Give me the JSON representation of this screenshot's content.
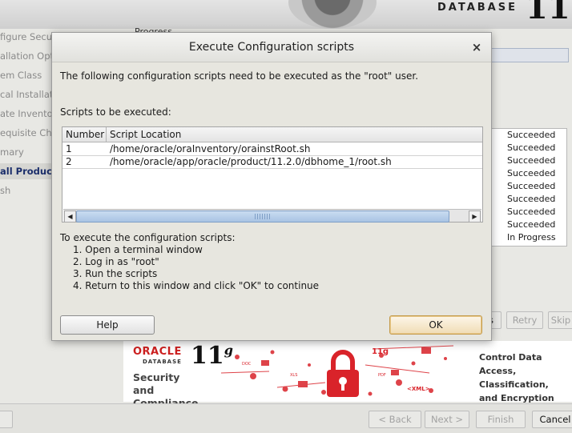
{
  "background": {
    "brand_text": "DATABASE",
    "brand_number": "11",
    "progress_link": "Progress",
    "sidebar": [
      {
        "label": "figure Secur",
        "active": false
      },
      {
        "label": "allation Opti",
        "active": false
      },
      {
        "label": "em Class",
        "active": false
      },
      {
        "label": "cal Installati",
        "active": false
      },
      {
        "label": "ate Inventory",
        "active": false
      },
      {
        "label": "equisite Che",
        "active": false
      },
      {
        "label": "mary",
        "active": false
      },
      {
        "label": "all Product",
        "active": true
      },
      {
        "label": "sh",
        "active": false
      }
    ],
    "status_items": [
      "Succeeded",
      "Succeeded",
      "Succeeded",
      "Succeeded",
      "Succeeded",
      "Succeeded",
      "Succeeded",
      "Succeeded",
      "In Progress"
    ],
    "side_buttons": {
      "details": "s",
      "retry": "Retry",
      "skip": "Skip"
    },
    "banner": {
      "oracle": "ORACLE",
      "database": "DATABASE",
      "version": "11",
      "version_sup": "g",
      "left_line1": "Security",
      "left_line2": "and Compliance",
      "right_line1": "Control Data Access,",
      "right_line2": "Classification,",
      "right_line3": "and Encryption",
      "art_words": [
        "11g",
        "<XML>",
        "PDF",
        "DOC",
        "XLS"
      ]
    },
    "bottom_buttons": {
      "back": "< Back",
      "next": "Next >",
      "finish": "Finish",
      "cancel": "Cancel"
    }
  },
  "dialog": {
    "title": "Execute Configuration scripts",
    "intro": "The following configuration scripts need to be executed as the \"root\" user.",
    "scripts_label": "Scripts to be executed:",
    "columns": [
      "Number",
      "Script Location"
    ],
    "rows": [
      {
        "number": "1",
        "location": "/home/oracle/oraInventory/orainstRoot.sh"
      },
      {
        "number": "2",
        "location": "/home/oracle/app/oracle/product/11.2.0/dbhome_1/root.sh"
      }
    ],
    "instructions_title": "To execute the configuration scripts:",
    "steps": [
      "1. Open a terminal window",
      "2. Log in as \"root\"",
      "3. Run the scripts",
      "4. Return to this window and click \"OK\" to continue"
    ],
    "help_label": "Help",
    "ok_label": "OK",
    "close_glyph": "×"
  }
}
